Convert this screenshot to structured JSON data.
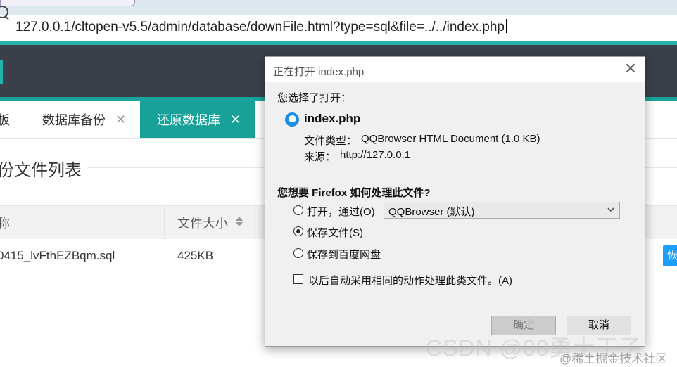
{
  "browser": {
    "url": "127.0.0.1/cltopen-v5.5/admin/database/downFile.html?type=sql&file=../../index.php"
  },
  "tabs": [
    {
      "label": "板",
      "closable": false,
      "active": false
    },
    {
      "label": "数据库备份",
      "closable": true,
      "active": false
    },
    {
      "label": "还原数据库",
      "closable": true,
      "active": true
    }
  ],
  "tab_close_glyph": "✕",
  "page": {
    "section_title": "份文件列表",
    "table": {
      "columns": [
        "称",
        "文件大小"
      ],
      "rows": [
        {
          "name": "0415_lvFthEZBqm.sql",
          "size": "425KB",
          "action": "恢"
        }
      ]
    }
  },
  "dialog": {
    "title": "正在打开 index.php",
    "intro": "您选择了打开：",
    "file_name": "index.php",
    "file_type_label": "文件类型：",
    "file_type": "QQBrowser HTML Document (1.0 KB)",
    "source_label": "来源：",
    "source": "http://127.0.0.1",
    "question": "您想要 Firefox 如何处理此文件?",
    "options": [
      {
        "label": "打开，通过(O)",
        "selected": false
      },
      {
        "label": "保存文件(S)",
        "selected": true
      },
      {
        "label": "保存到百度网盘",
        "selected": false
      }
    ],
    "open_with_app": "QQBrowser (默认)",
    "remember_label": "以后自动采用相同的动作处理此类文件。(A)",
    "remember_checked": false,
    "ok_label": "确定",
    "cancel_label": "取消",
    "close_glyph": "✕"
  },
  "watermark": {
    "text_large": "CSDN @00勇士王子",
    "text_small": "@稀土掘金技术社区"
  },
  "colors": {
    "teal": "#18a198",
    "header_dark": "#3a3f4a",
    "restore_blue": "#1e9fff"
  }
}
